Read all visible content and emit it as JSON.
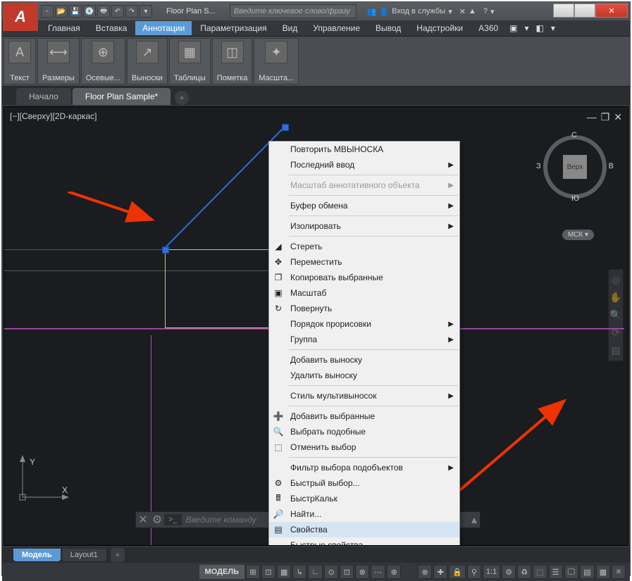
{
  "app": {
    "logo_letter": "A",
    "title": "Floor Plan S..."
  },
  "qat_icons": [
    "new",
    "open",
    "save",
    "saveas",
    "plot",
    "undo",
    "redo"
  ],
  "search_placeholder": "Введите ключевое слово/фразу",
  "login": {
    "icon1": "👥",
    "icon2": "👤",
    "label": "Вход в службы",
    "dd": "▾",
    "ex": "✕",
    "a": "▲",
    "help": "?",
    "dd2": "▾"
  },
  "win_buttons": {
    "min": "—",
    "max": "❐",
    "close": "✕"
  },
  "menu_tabs": [
    "Главная",
    "Вставка",
    "Аннотации",
    "Параметризация",
    "Вид",
    "Управление",
    "Вывод",
    "Надстройки",
    "A360"
  ],
  "menu_extra": [
    "▣",
    "▾",
    "◧",
    "▾"
  ],
  "menu_active_index": 2,
  "ribbon_panels": [
    {
      "icon": "A",
      "label": "Текст"
    },
    {
      "icon": "⟷",
      "label": "Размеры"
    },
    {
      "icon": "⊕",
      "label": "Осевые..."
    },
    {
      "icon": "↗",
      "label": "Выноски"
    },
    {
      "icon": "▦",
      "label": "Таблицы"
    },
    {
      "icon": "◫",
      "label": "Пометка"
    },
    {
      "icon": "✦",
      "label": "Масшта..."
    }
  ],
  "doc_tabs": {
    "items": [
      "Начало",
      "Floor Plan Sample*"
    ],
    "active_index": 1,
    "add": "+"
  },
  "canvas": {
    "view_label": "[−][Сверху][2D-каркас]",
    "view_ctrl": [
      "—",
      "❐",
      "✕"
    ],
    "viewcube": {
      "n": "С",
      "e": "В",
      "s": "Ю",
      "w": "З",
      "face": "Верх"
    },
    "wcs": "МСК ▾",
    "ucs": {
      "y": "Y",
      "x": "X"
    }
  },
  "context_menu": [
    {
      "type": "item",
      "label": "Повторить МВЫНОСКА"
    },
    {
      "type": "item",
      "label": "Последний ввод",
      "submenu": true
    },
    {
      "type": "sep"
    },
    {
      "type": "item",
      "label": "Масштаб аннотативного объекта",
      "submenu": true,
      "disabled": true
    },
    {
      "type": "sep"
    },
    {
      "type": "item",
      "label": "Буфер обмена",
      "submenu": true
    },
    {
      "type": "sep"
    },
    {
      "type": "item",
      "label": "Изолировать",
      "submenu": true
    },
    {
      "type": "sep"
    },
    {
      "type": "item",
      "label": "Стереть",
      "icon": "eraser"
    },
    {
      "type": "item",
      "label": "Переместить",
      "icon": "move"
    },
    {
      "type": "item",
      "label": "Копировать выбранные",
      "icon": "copy"
    },
    {
      "type": "item",
      "label": "Масштаб",
      "icon": "scale"
    },
    {
      "type": "item",
      "label": "Повернуть",
      "icon": "rotate"
    },
    {
      "type": "item",
      "label": "Порядок прорисовки",
      "submenu": true
    },
    {
      "type": "item",
      "label": "Группа",
      "submenu": true
    },
    {
      "type": "sep"
    },
    {
      "type": "item",
      "label": "Добавить выноску"
    },
    {
      "type": "item",
      "label": "Удалить выноску"
    },
    {
      "type": "sep"
    },
    {
      "type": "item",
      "label": "Стиль мультивыносок",
      "submenu": true
    },
    {
      "type": "sep"
    },
    {
      "type": "item",
      "label": "Добавить выбранные",
      "icon": "add-sel"
    },
    {
      "type": "item",
      "label": "Выбрать подобные",
      "icon": "similar"
    },
    {
      "type": "item",
      "label": "Отменить выбор",
      "icon": "deselect"
    },
    {
      "type": "sep"
    },
    {
      "type": "item",
      "label": "Фильтр выбора подобъектов",
      "submenu": true
    },
    {
      "type": "item",
      "label": "Быстрый выбор...",
      "icon": "qselect"
    },
    {
      "type": "item",
      "label": "БыстрКальк",
      "icon": "calc"
    },
    {
      "type": "item",
      "label": "Найти...",
      "icon": "find"
    },
    {
      "type": "item",
      "label": "Свойства",
      "icon": "props",
      "highlight": true
    },
    {
      "type": "item",
      "label": "Быстрые свойства"
    }
  ],
  "cm_icon_glyphs": {
    "eraser": "◢",
    "move": "✥",
    "copy": "❐",
    "scale": "▣",
    "rotate": "↻",
    "add-sel": "➕",
    "similar": "🔍",
    "deselect": "⬚",
    "qselect": "⚙",
    "calc": "🖩",
    "find": "🔎",
    "props": "▤"
  },
  "cmdline": {
    "x": "✕",
    "settings": "⚙",
    "prompt": ">_",
    "placeholder": "Введите команду"
  },
  "layout_tabs": {
    "items": [
      "Модель",
      "Layout1"
    ],
    "active_index": 0,
    "add": "+"
  },
  "statusbar": {
    "model_label": "МОДЕЛЬ",
    "buttons_left": [
      "⊞",
      "⊡",
      "▦",
      "↳",
      "∟",
      "⊙",
      "⊡",
      "⊗",
      "⋯",
      "⊕"
    ],
    "buttons_right": [
      "⊗",
      "✚",
      "🔒",
      "⚲",
      "1:1",
      "⚙",
      "♻",
      "⬚",
      "☰",
      "🖵",
      "▤",
      "▦",
      "≡"
    ]
  }
}
